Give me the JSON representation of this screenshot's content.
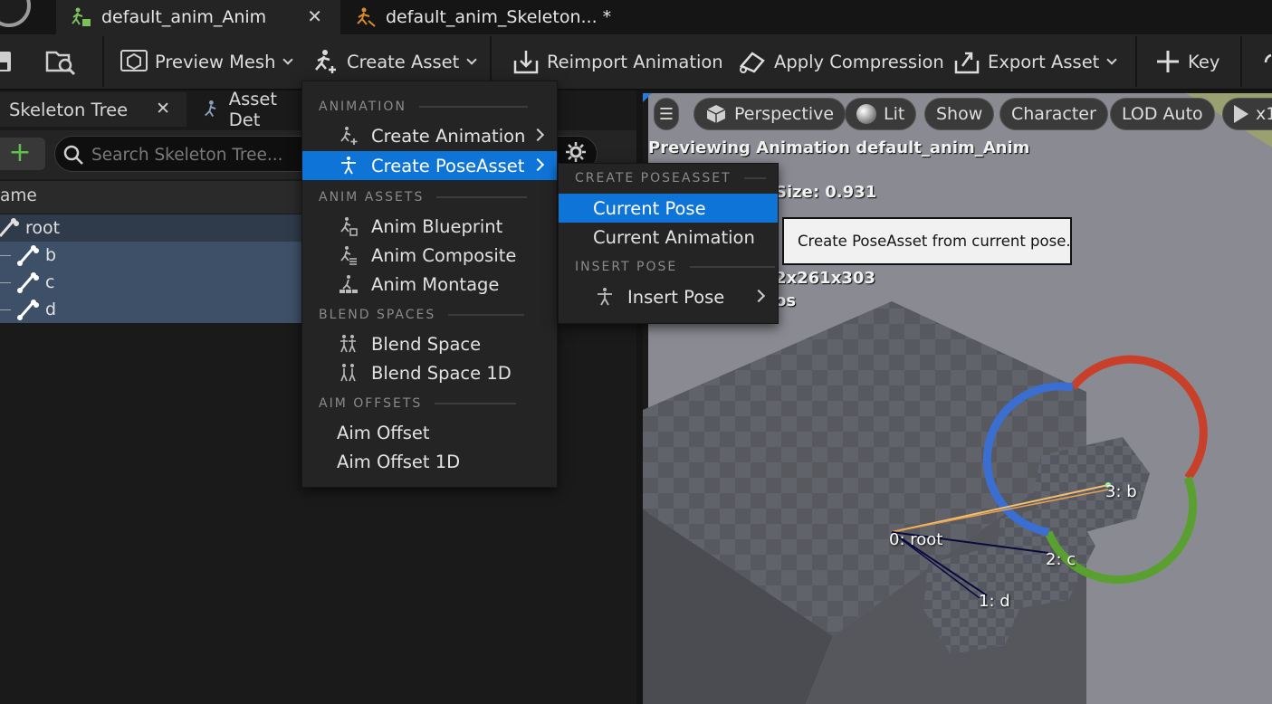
{
  "tabs": [
    {
      "label": "default_anim_Anim",
      "active": true,
      "closable": true
    },
    {
      "label": "default_anim_Skeleton... *",
      "active": false,
      "closable": false
    }
  ],
  "toolbar": {
    "preview_mesh": "Preview Mesh",
    "create_asset": "Create Asset",
    "reimport_animation": "Reimport Animation",
    "apply_compression": "Apply Compression",
    "export_asset": "Export Asset",
    "key": "Key"
  },
  "left_panel": {
    "tabs": [
      {
        "label": "Skeleton Tree",
        "active": true
      },
      {
        "label": "Asset Det",
        "active": false
      }
    ],
    "search_placeholder": "Search Skeleton Tree...",
    "column_header": "ame",
    "tree": [
      {
        "label": "root",
        "selected": false
      },
      {
        "label": "b",
        "selected": true
      },
      {
        "label": "c",
        "selected": true
      },
      {
        "label": "d",
        "selected": true
      }
    ]
  },
  "create_menu": {
    "sections": [
      {
        "header": "ANIMATION",
        "items": [
          {
            "label": "Create Animation",
            "submenu": true,
            "highlighted": false
          },
          {
            "label": "Create PoseAsset",
            "submenu": true,
            "highlighted": true
          }
        ]
      },
      {
        "header": "ANIM ASSETS",
        "items": [
          {
            "label": "Anim Blueprint"
          },
          {
            "label": "Anim Composite"
          },
          {
            "label": "Anim Montage"
          }
        ]
      },
      {
        "header": "BLEND SPACES",
        "items": [
          {
            "label": "Blend Space"
          },
          {
            "label": "Blend Space 1D"
          }
        ]
      },
      {
        "header": "AIM OFFSETS",
        "items": [
          {
            "label": "Aim Offset"
          },
          {
            "label": "Aim Offset 1D"
          }
        ]
      }
    ]
  },
  "pose_menu": {
    "header_create": "CREATE POSEASSET",
    "items": [
      {
        "label": "Current Pose",
        "highlighted": true
      },
      {
        "label": "Current Animation",
        "highlighted": false
      }
    ],
    "header_insert": "INSERT POSE",
    "insert_item": "Insert Pose"
  },
  "tooltip": "Create PoseAsset from current pose.",
  "viewport": {
    "pills": [
      "Perspective",
      "Lit",
      "Show",
      "Character",
      "LOD Auto",
      "x1"
    ],
    "previewing": "Previewing Animation default_anim_Anim",
    "size_text": "Size: 0.931",
    "dims_text": "2x261x303",
    "partial_text": "os",
    "bones": [
      "0: root",
      "1: d",
      "2: c",
      "3: b"
    ]
  },
  "colors": {
    "highlight": "#0f74d8",
    "selection": "#3e5068",
    "add_green": "#5ec14b"
  }
}
